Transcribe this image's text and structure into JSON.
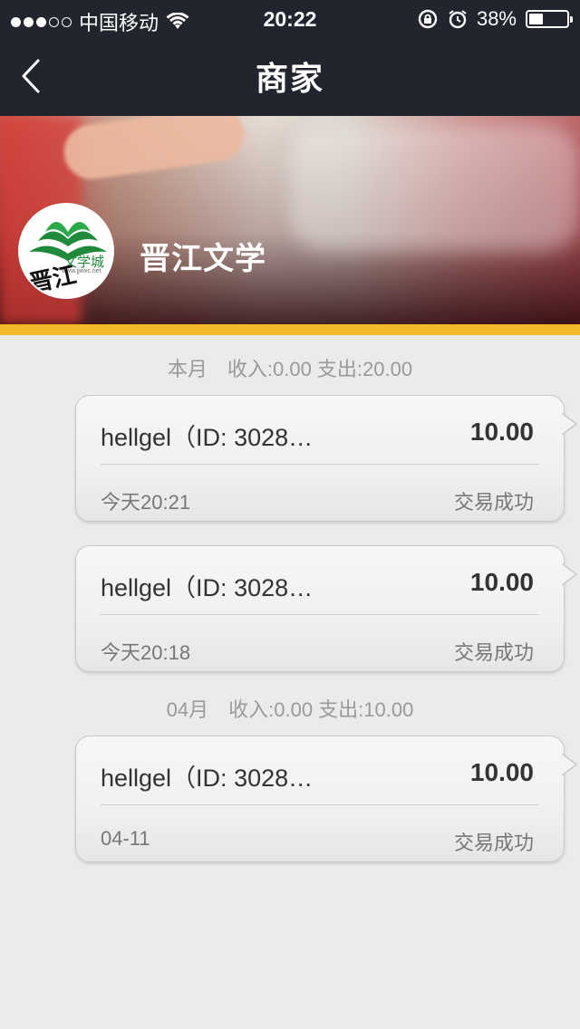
{
  "status_bar": {
    "carrier": "中国移动",
    "time": "20:22",
    "battery_percent": "38%",
    "battery_level": 0.38
  },
  "nav": {
    "title": "商家",
    "back_icon": "chevron-left-icon"
  },
  "merchant": {
    "name": "晋江文学",
    "logo_text": "文学城",
    "logo_url_text": "www.jjwxc.net",
    "logo_calligraphy": "晋江"
  },
  "colors": {
    "nav_bg": "#22252e",
    "accent": "#f4b92b",
    "page_bg": "#ebebeb"
  },
  "groups": [
    {
      "header": "本月　收入:0.00  支出:20.00",
      "items": [
        {
          "who": "hellgel（ID: 3028…",
          "amount": "10.00",
          "when": "今天20:21",
          "status": "交易成功"
        },
        {
          "who": "hellgel（ID: 3028…",
          "amount": "10.00",
          "when": "今天20:18",
          "status": "交易成功"
        }
      ]
    },
    {
      "header": "04月　收入:0.00  支出:10.00",
      "items": [
        {
          "who": "hellgel（ID: 3028…",
          "amount": "10.00",
          "when": "04-11",
          "status": "交易成功"
        }
      ]
    }
  ]
}
